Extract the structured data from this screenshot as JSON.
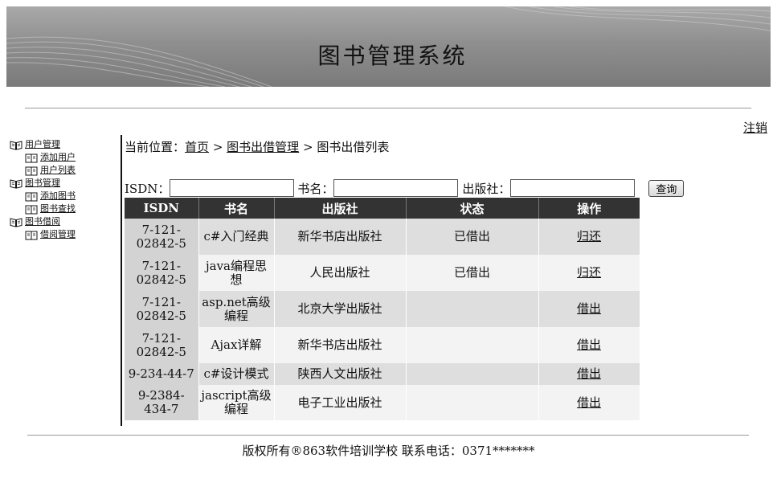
{
  "header": {
    "title": "图书管理系统"
  },
  "logout_label": "注销",
  "sidebar": {
    "groups": [
      {
        "label": "用户管理",
        "icon": "book-icon",
        "children": [
          "添加用户",
          "用户列表"
        ]
      },
      {
        "label": "图书管理",
        "icon": "book-icon",
        "children": [
          "添加图书",
          "图书查找"
        ]
      },
      {
        "label": "图书借阅",
        "icon": "book-icon",
        "children": [
          "借阅管理"
        ]
      }
    ]
  },
  "breadcrumb": {
    "prefix": "当前位置：",
    "home": "首页",
    "sep": ">",
    "section": "图书出借管理",
    "current": "图书出借列表"
  },
  "search": {
    "isdn_label": "ISDN：",
    "name_label": "书名：",
    "publisher_label": "出版社：",
    "isdn_value": "",
    "name_value": "",
    "publisher_value": "",
    "query_button": "查询"
  },
  "table": {
    "headers": [
      "ISDN",
      "书名",
      "出版社",
      "状态",
      "操作"
    ],
    "rows": [
      {
        "isdn": "7-121-02842-5",
        "name": "c#入门经典",
        "publisher": "新华书店出版社",
        "status": "已借出",
        "action": "归还"
      },
      {
        "isdn": "7-121-02842-5",
        "name": "java编程思想",
        "publisher": "人民出版社",
        "status": "已借出",
        "action": "归还"
      },
      {
        "isdn": "7-121-02842-5",
        "name": "asp.net高级编程",
        "publisher": "北京大学出版社",
        "status": "",
        "action": "借出"
      },
      {
        "isdn": "7-121-02842-5",
        "name": "Ajax详解",
        "publisher": "新华书店出版社",
        "status": "",
        "action": "借出"
      },
      {
        "isdn": "9-234-44-7",
        "name": "c#设计模式",
        "publisher": "陕西人文出版社",
        "status": "",
        "action": "借出"
      },
      {
        "isdn": "9-2384-434-7",
        "name": "jascript高级编程",
        "publisher": "电子工业出版社",
        "status": "",
        "action": "借出"
      }
    ]
  },
  "footer": {
    "text": "版权所有®863软件培训学校 联系电话：0371*******"
  },
  "colors": {
    "header_bg": "#333333",
    "row_odd": "#dedede",
    "row_even": "#f3f3f3"
  }
}
